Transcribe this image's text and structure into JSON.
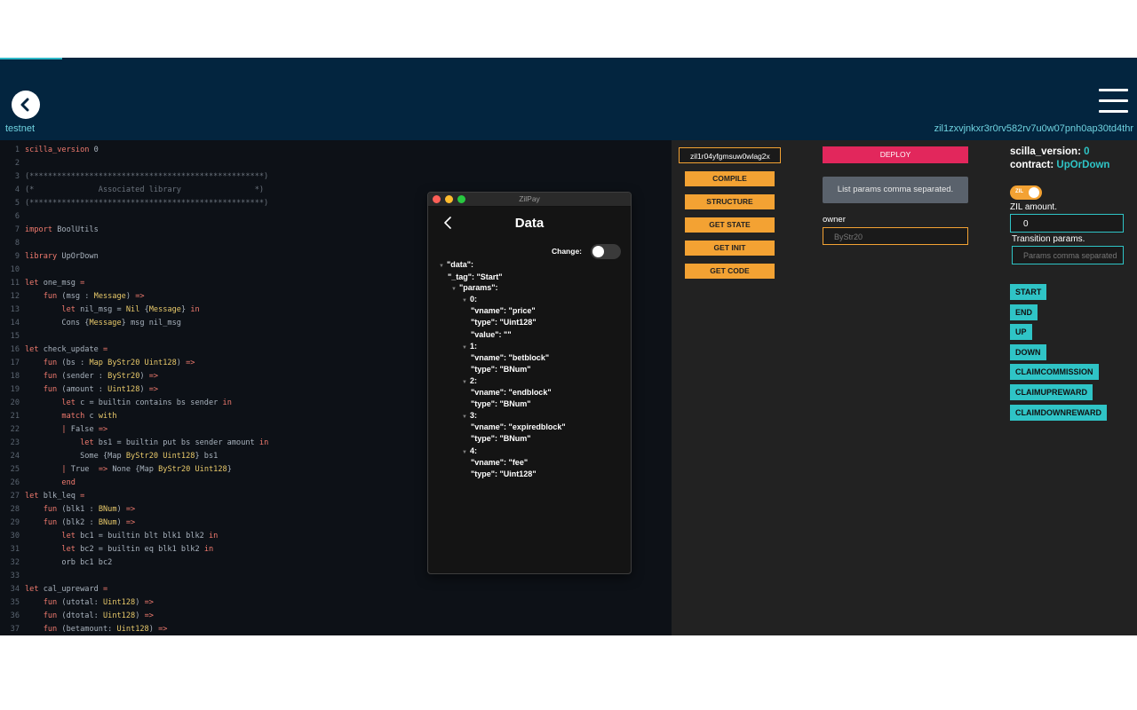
{
  "header": {
    "network": "testnet",
    "address": "zil1zxvjnkxr3r0rv582rv7u0w07pnh0ap30td4thr"
  },
  "editor": {
    "lines": [
      {
        "n": "1",
        "parts": [
          [
            "kw",
            "scilla_version"
          ],
          [
            "id",
            " 0"
          ]
        ]
      },
      {
        "n": "2",
        "parts": []
      },
      {
        "n": "3",
        "parts": [
          [
            "cm",
            "(***************************************************)"
          ]
        ]
      },
      {
        "n": "4",
        "parts": [
          [
            "cm",
            "(*              Associated library                *)"
          ]
        ]
      },
      {
        "n": "5",
        "parts": [
          [
            "cm",
            "(***************************************************)"
          ]
        ]
      },
      {
        "n": "6",
        "parts": []
      },
      {
        "n": "7",
        "parts": [
          [
            "kw",
            "import"
          ],
          [
            "id",
            " BoolUtils"
          ]
        ]
      },
      {
        "n": "8",
        "parts": []
      },
      {
        "n": "9",
        "parts": [
          [
            "kw",
            "library"
          ],
          [
            "id",
            " UpOrDown"
          ]
        ]
      },
      {
        "n": "10",
        "parts": []
      },
      {
        "n": "11",
        "parts": [
          [
            "kw",
            "let"
          ],
          [
            "id",
            " one_msg "
          ],
          [
            "kw",
            "="
          ]
        ]
      },
      {
        "n": "12",
        "parts": [
          [
            "id",
            "    "
          ],
          [
            "kw",
            "fun"
          ],
          [
            "id",
            " (msg : "
          ],
          [
            "ty",
            "Message"
          ],
          [
            "id",
            ") "
          ],
          [
            "kw",
            "=>"
          ]
        ]
      },
      {
        "n": "13",
        "parts": [
          [
            "id",
            "        "
          ],
          [
            "kw",
            "let"
          ],
          [
            "id",
            " nil_msg = "
          ],
          [
            "ty",
            "Nil"
          ],
          [
            "id",
            " {"
          ],
          [
            "ty",
            "Message"
          ],
          [
            "id",
            "} "
          ],
          [
            "kw",
            "in"
          ]
        ]
      },
      {
        "n": "14",
        "parts": [
          [
            "id",
            "        Cons {"
          ],
          [
            "ty",
            "Message"
          ],
          [
            "id",
            "} msg nil_msg"
          ]
        ]
      },
      {
        "n": "15",
        "parts": []
      },
      {
        "n": "16",
        "parts": [
          [
            "kw",
            "let"
          ],
          [
            "id",
            " check_update "
          ],
          [
            "kw",
            "="
          ]
        ]
      },
      {
        "n": "17",
        "parts": [
          [
            "id",
            "    "
          ],
          [
            "kw",
            "fun"
          ],
          [
            "id",
            " (bs : "
          ],
          [
            "ty",
            "Map ByStr20 Uint128"
          ],
          [
            "id",
            ") "
          ],
          [
            "kw",
            "=>"
          ]
        ]
      },
      {
        "n": "18",
        "parts": [
          [
            "id",
            "    "
          ],
          [
            "kw",
            "fun"
          ],
          [
            "id",
            " (sender : "
          ],
          [
            "ty",
            "ByStr20"
          ],
          [
            "id",
            ") "
          ],
          [
            "kw",
            "=>"
          ]
        ]
      },
      {
        "n": "19",
        "parts": [
          [
            "id",
            "    "
          ],
          [
            "kw",
            "fun"
          ],
          [
            "id",
            " (amount : "
          ],
          [
            "ty",
            "Uint128"
          ],
          [
            "id",
            ") "
          ],
          [
            "kw",
            "=>"
          ]
        ]
      },
      {
        "n": "20",
        "parts": [
          [
            "id",
            "        "
          ],
          [
            "kw",
            "let"
          ],
          [
            "id",
            " c = builtin contains bs sender "
          ],
          [
            "kw",
            "in"
          ]
        ]
      },
      {
        "n": "21",
        "parts": [
          [
            "id",
            "        "
          ],
          [
            "kw",
            "match"
          ],
          [
            "id",
            " c "
          ],
          [
            "ty",
            "with"
          ]
        ]
      },
      {
        "n": "22",
        "parts": [
          [
            "id",
            "        "
          ],
          [
            "kw",
            "|"
          ],
          [
            "id",
            " False "
          ],
          [
            "kw",
            "=>"
          ]
        ]
      },
      {
        "n": "23",
        "parts": [
          [
            "id",
            "            "
          ],
          [
            "kw",
            "let"
          ],
          [
            "id",
            " bs1 = builtin put bs sender amount "
          ],
          [
            "kw",
            "in"
          ]
        ]
      },
      {
        "n": "24",
        "parts": [
          [
            "id",
            "            Some {"
          ],
          [
            "id",
            "Map "
          ],
          [
            "ty",
            "ByStr20 Uint128"
          ],
          [
            "id",
            "} bs1"
          ]
        ]
      },
      {
        "n": "25",
        "parts": [
          [
            "id",
            "        "
          ],
          [
            "kw",
            "|"
          ],
          [
            "id",
            " True  "
          ],
          [
            "kw",
            "=>"
          ],
          [
            "id",
            " None {Map "
          ],
          [
            "ty",
            "ByStr20 Uint128"
          ],
          [
            "id",
            "}"
          ]
        ]
      },
      {
        "n": "26",
        "parts": [
          [
            "id",
            "        "
          ],
          [
            "kw",
            "end"
          ]
        ]
      },
      {
        "n": "27",
        "parts": [
          [
            "kw",
            "let"
          ],
          [
            "id",
            " blk_leq "
          ],
          [
            "kw",
            "="
          ]
        ]
      },
      {
        "n": "28",
        "parts": [
          [
            "id",
            "    "
          ],
          [
            "kw",
            "fun"
          ],
          [
            "id",
            " (blk1 : "
          ],
          [
            "ty",
            "BNum"
          ],
          [
            "id",
            ") "
          ],
          [
            "kw",
            "=>"
          ]
        ]
      },
      {
        "n": "29",
        "parts": [
          [
            "id",
            "    "
          ],
          [
            "kw",
            "fun"
          ],
          [
            "id",
            " (blk2 : "
          ],
          [
            "ty",
            "BNum"
          ],
          [
            "id",
            ") "
          ],
          [
            "kw",
            "=>"
          ]
        ]
      },
      {
        "n": "30",
        "parts": [
          [
            "id",
            "        "
          ],
          [
            "kw",
            "let"
          ],
          [
            "id",
            " bc1 = builtin blt blk1 blk2 "
          ],
          [
            "kw",
            "in"
          ]
        ]
      },
      {
        "n": "31",
        "parts": [
          [
            "id",
            "        "
          ],
          [
            "kw",
            "let"
          ],
          [
            "id",
            " bc2 = builtin eq blk1 blk2 "
          ],
          [
            "kw",
            "in"
          ]
        ]
      },
      {
        "n": "32",
        "parts": [
          [
            "id",
            "        orb bc1 bc2"
          ]
        ]
      },
      {
        "n": "33",
        "parts": []
      },
      {
        "n": "34",
        "parts": [
          [
            "kw",
            "let"
          ],
          [
            "id",
            " cal_upreward "
          ],
          [
            "kw",
            "="
          ]
        ]
      },
      {
        "n": "35",
        "parts": [
          [
            "id",
            "    "
          ],
          [
            "kw",
            "fun"
          ],
          [
            "id",
            " (utotal: "
          ],
          [
            "ty",
            "Uint128"
          ],
          [
            "id",
            ") "
          ],
          [
            "kw",
            "=>"
          ]
        ]
      },
      {
        "n": "36",
        "parts": [
          [
            "id",
            "    "
          ],
          [
            "kw",
            "fun"
          ],
          [
            "id",
            " (dtotal: "
          ],
          [
            "ty",
            "Uint128"
          ],
          [
            "id",
            ") "
          ],
          [
            "kw",
            "=>"
          ]
        ]
      },
      {
        "n": "37",
        "parts": [
          [
            "id",
            "    "
          ],
          [
            "kw",
            "fun"
          ],
          [
            "id",
            " (betamount: "
          ],
          [
            "ty",
            "Uint128"
          ],
          [
            "id",
            ") "
          ],
          [
            "kw",
            "=>"
          ]
        ]
      }
    ]
  },
  "popup": {
    "window_title": "ZilPay",
    "heading": "Data",
    "change_label": "Change:",
    "tree": [
      {
        "t": "\"data\":",
        "arrow": true
      },
      {
        "t": "\"_tag\":  \"Start\"",
        "arrow": false
      },
      {
        "t": "\"params\":",
        "arrow": true
      },
      {
        "t": "0:",
        "arrow": true
      },
      {
        "t": "\"vname\":  \"price\"",
        "arrow": false
      },
      {
        "t": "\"type\":  \"Uint128\"",
        "arrow": false
      },
      {
        "t": "\"value\":  \"\"",
        "arrow": false
      },
      {
        "t": "1:",
        "arrow": true
      },
      {
        "t": "\"vname\":  \"betblock\"",
        "arrow": false
      },
      {
        "t": "\"type\":  \"BNum\"",
        "arrow": false
      },
      {
        "t": "2:",
        "arrow": true
      },
      {
        "t": "\"vname\":  \"endblock\"",
        "arrow": false
      },
      {
        "t": "\"type\":  \"BNum\"",
        "arrow": false
      },
      {
        "t": "3:",
        "arrow": true
      },
      {
        "t": "\"vname\":  \"expiredblock\"",
        "arrow": false
      },
      {
        "t": "\"type\":  \"BNum\"",
        "arrow": false
      },
      {
        "t": "4:",
        "arrow": true
      },
      {
        "t": "\"vname\":  \"fee\"",
        "arrow": false
      },
      {
        "t": "\"type\":  \"Uint128\"",
        "arrow": false
      }
    ]
  },
  "panel": {
    "contract_address": "zil1r04yfgmsuw0wlag2x",
    "actions": [
      "COMPILE",
      "STRUCTURE",
      "GET STATE",
      "GET INIT",
      "GET CODE"
    ],
    "deploy_label": "DEPLOY",
    "params_hint": "List params comma separated.",
    "owner_label": "owner",
    "owner_placeholder": "ByStr20",
    "scilla_version_label": "scilla_version:",
    "scilla_version_value": "0",
    "contract_label": "contract:",
    "contract_value": "UpOrDown",
    "zil_toggle_label": "ZIL",
    "zil_amount_label": "ZIL amount.",
    "zil_amount_value": "0",
    "transition_params_label": "Transition params.",
    "transition_params_placeholder": "Params comma separated",
    "transitions": [
      "START",
      "END",
      "UP",
      "DOWN",
      "CLAIMCOMMISSION",
      "CLAIMUPREWARD",
      "CLAIMDOWNREWARD"
    ]
  },
  "colors": {
    "header_bg": "#03253f",
    "accent_teal": "#2fc4c6",
    "accent_orange": "#f3a233",
    "deploy_red": "#e2275c",
    "editor_bg": "#0d1117",
    "panel_bg": "#222222"
  }
}
